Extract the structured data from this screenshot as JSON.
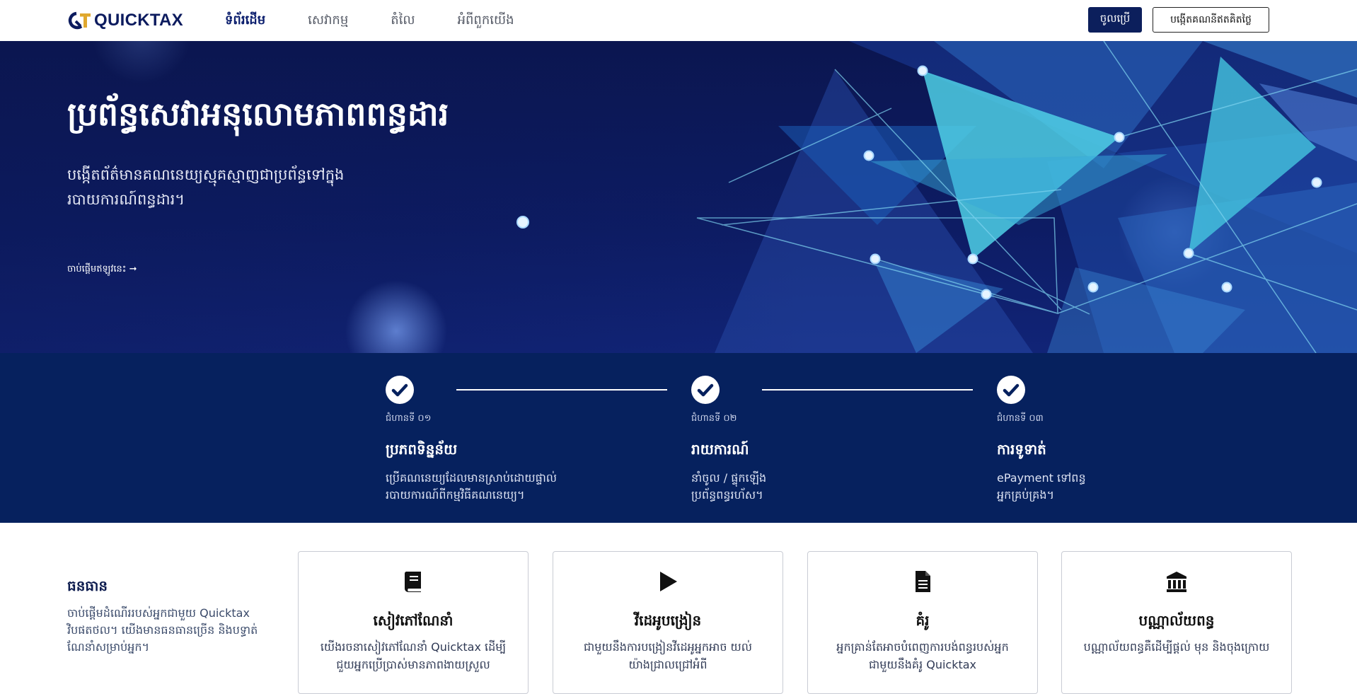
{
  "nav": {
    "logo_text": "QUICKTAX",
    "links": [
      "ទំព័រដើម",
      "សេវាកម្ម",
      "តំលៃ",
      "អំពីពួកយើង"
    ],
    "login_label": "ចូលប្រើ",
    "signup_label": "បង្កើតគណនីឥតគិតថ្លៃ"
  },
  "hero": {
    "title": "ប្រព័ន្ធសេវាអនុលោមភាពពន្ធដារ",
    "subtitle": "បង្កើតព័ត៌មានគណនេយ្យស្មុគស្មាញជាប្រព័ន្ធទៅក្នុងរបាយការណ៍ពន្ធដារ។",
    "cta_label": "ចាប់ផ្តើមឥឡូវនេះ",
    "cta_arrow": "➞"
  },
  "steps": [
    {
      "number": "ជំហានទី ០១",
      "title": "ប្រភពទិន្នន័យ",
      "description": "ប្រើគណនេយ្យដែលមានស្រាប់ដោយផ្ទាល់\nរបាយការណ៍ពីកម្មវិធីគណនេយ្យ។"
    },
    {
      "number": "ជំហានទី ០២",
      "title": "រាយការណ៍",
      "description": "នាំចូល / ផ្ទុកឡើង\nប្រព័ន្ធពន្ធរហ័ស។"
    },
    {
      "number": "ជំហានទី ០៣",
      "title": "ការទូទាត់",
      "description": "ePayment ទៅពន្ធ\nអ្នកគ្រប់គ្រង។"
    }
  ],
  "resources": {
    "heading": "ធនធាន",
    "text": "ចាប់ផ្តើមដំណើររបស់អ្នកជាមួយ Quicktax វិបផតថល។ យើងមានធនធានច្រើន និងបទ្ធាត់ណែនាំសម្រាប់អ្នក។",
    "cards": [
      {
        "icon": "book-icon",
        "title": "សៀវភៅណែនាំ",
        "description": "យើងរចនាសៀវភៅណែនាំ Quicktax ដើម្បីជួយអ្នកប្រើប្រាស់មានភាពងាយស្រួល"
      },
      {
        "icon": "play-icon",
        "title": "វីដេអូបង្រៀន",
        "description": "ជាមួយនឹងការបង្រៀនវីដេអូអ្នកអាច យល់យ៉ាងជ្រាលជ្រៅអំពី"
      },
      {
        "icon": "document-icon",
        "title": "គំរូ",
        "description": "អ្នកគ្រាន់តែអាចបំពេញការបង់ពន្ធរបស់អ្នក ជាមួយនឹងគំរូ Quicktax"
      },
      {
        "icon": "bank-icon",
        "title": "បណ្ណាល័យពន្ធ",
        "description": "បណ្ណាល័យពន្ធគឺដើម្បីផ្តល់ មុន និងចុងក្រោយ"
      }
    ]
  },
  "colors": {
    "brand_navy": "#0c1f5c",
    "hero_bg": "#0d1c64",
    "steps_bg": "#06215e",
    "logo_gold": "#e0a82e",
    "accent_cyan": "#4fd0e6"
  }
}
